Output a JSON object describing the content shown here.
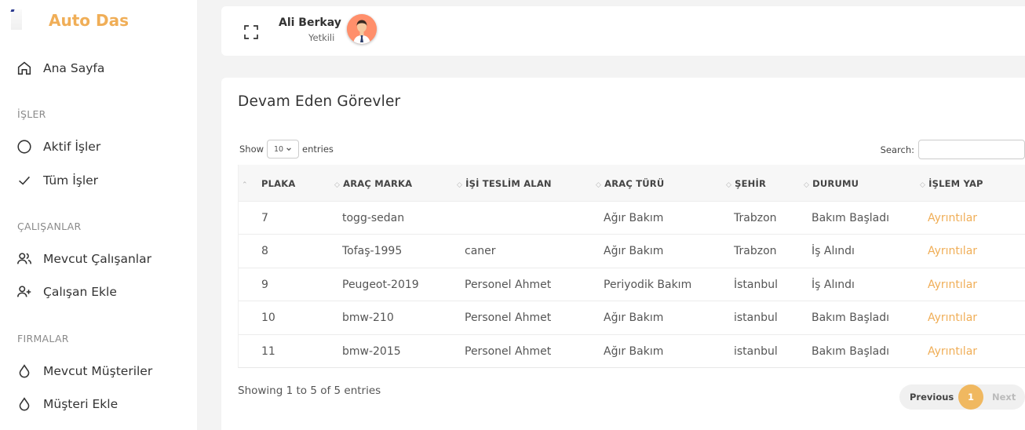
{
  "app": {
    "name": "Auto Das",
    "accent": "#f0ae57"
  },
  "sidebar": {
    "home": "Ana Sayfa",
    "sections": [
      {
        "title": "İŞLER",
        "items": [
          {
            "label": "Aktif İşler",
            "icon": "circle-icon"
          },
          {
            "label": "Tüm İşler",
            "icon": "check-icon"
          }
        ]
      },
      {
        "title": "ÇALIŞANLAR",
        "items": [
          {
            "label": "Mevcut Çalışanlar",
            "icon": "users-icon"
          },
          {
            "label": "Çalışan Ekle",
            "icon": "user-plus-icon"
          }
        ]
      },
      {
        "title": "FIRMALAR",
        "items": [
          {
            "label": "Mevcut Müşteriler",
            "icon": "droplet-icon"
          },
          {
            "label": "Müşteri Ekle",
            "icon": "droplet-icon"
          }
        ]
      }
    ]
  },
  "header": {
    "user_name": "Ali Berkay",
    "user_role": "Yetkili"
  },
  "card": {
    "title": "Devam Eden Görevler",
    "show_label": "Show",
    "entries_label": "entries",
    "page_length": "10",
    "search_label": "Search:",
    "search_value": "",
    "columns": [
      "PLAKA",
      "ARAÇ MARKA",
      "İŞİ TESLİM ALAN",
      "ARAÇ TÜRÜ",
      "ŞEHİR",
      "DURUMU",
      "İŞLEM YAP"
    ],
    "rows": [
      [
        "7",
        "togg-sedan",
        "",
        "Ağır Bakım",
        "Trabzon",
        "Bakım Başladı",
        "Ayrıntılar"
      ],
      [
        "8",
        "Tofaş-1995",
        "caner",
        "Ağır Bakım",
        "Trabzon",
        "İş Alındı",
        "Ayrıntılar"
      ],
      [
        "9",
        "Peugeot-2019",
        "Personel Ahmet",
        "Periyodik Bakım",
        "İstanbul",
        "İş Alındı",
        "Ayrıntılar"
      ],
      [
        "10",
        "bmw-210",
        "Personel Ahmet",
        "Ağır Bakım",
        "istanbul",
        "Bakım Başladı",
        "Ayrıntılar"
      ],
      [
        "11",
        "bmw-2015",
        "Personel Ahmet",
        "Ağır Bakım",
        "istanbul",
        "Bakım Başladı",
        "Ayrıntılar"
      ]
    ],
    "info": "Showing 1 to 5 of 5 entries",
    "pagination": {
      "previous": "Previous",
      "current": "1",
      "next": "Next"
    }
  }
}
